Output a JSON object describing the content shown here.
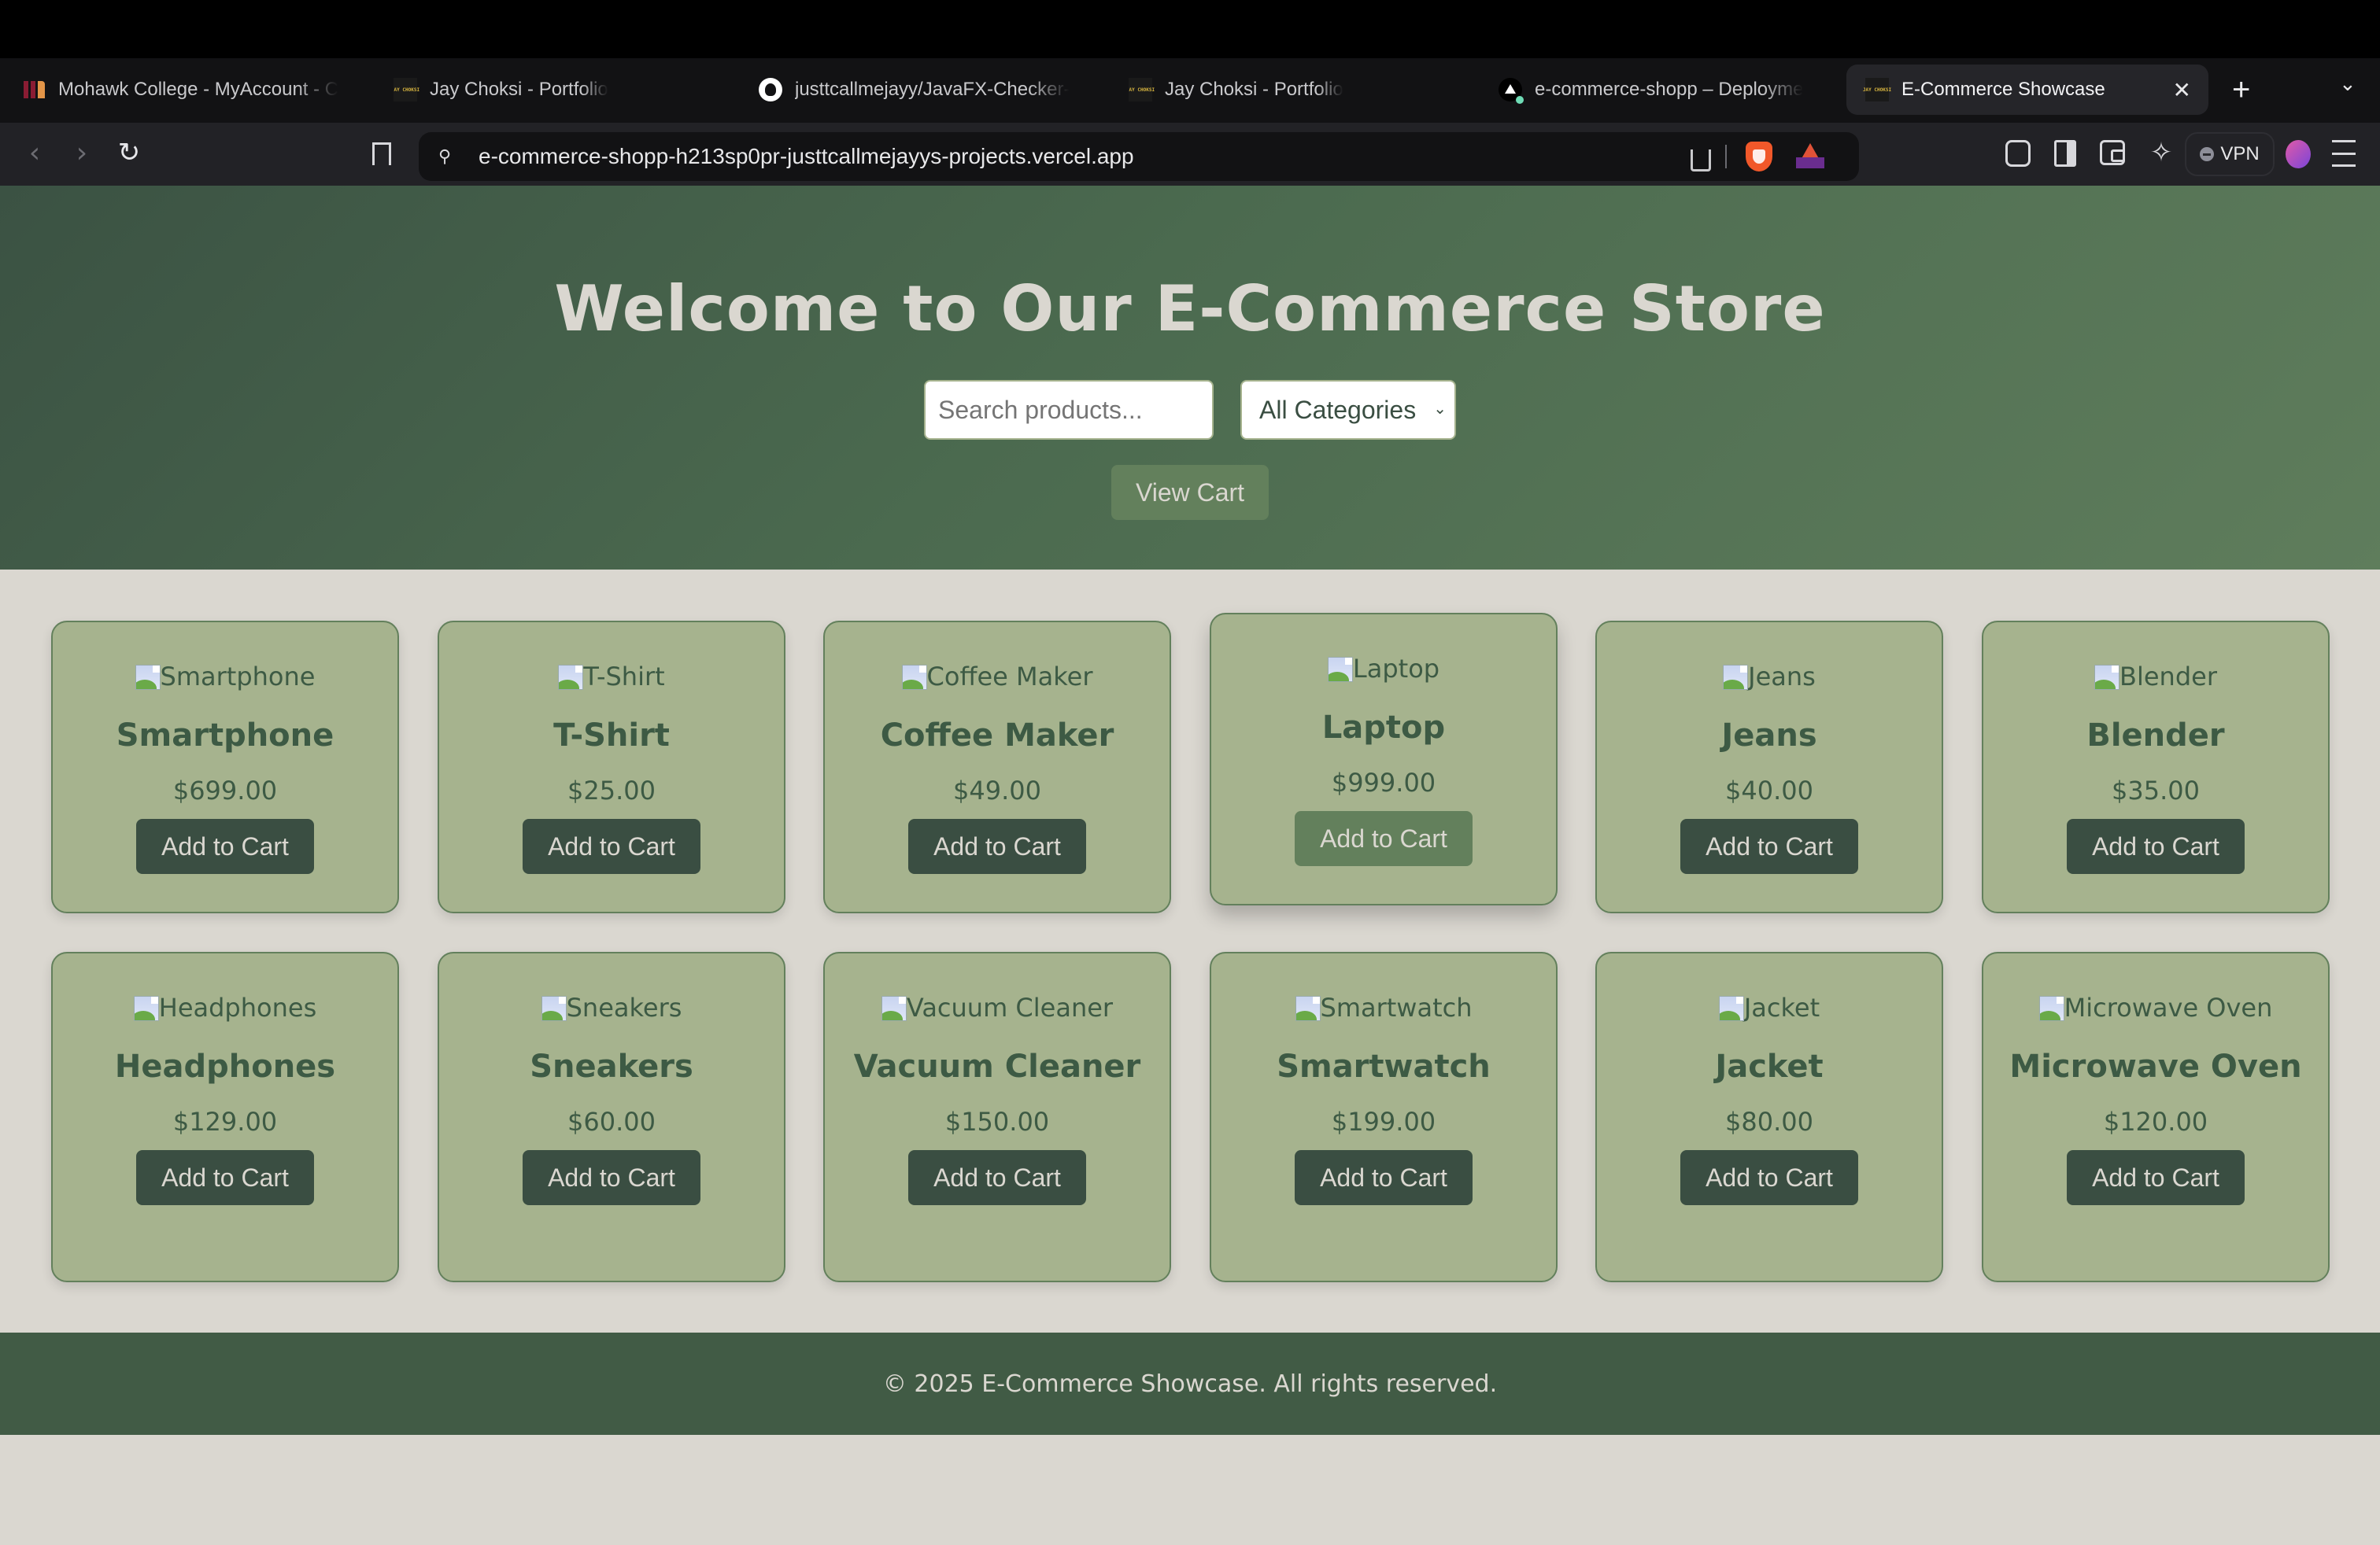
{
  "browser": {
    "tabs": [
      {
        "title": "Mohawk College - MyAccount - C",
        "favicon": "mohawk-icon",
        "active": false
      },
      {
        "title": "Jay Choksi - Portfolio",
        "favicon": "jay-choksi-icon",
        "active": false
      },
      {
        "title": "justtcallmejayy/JavaFX-Checker-",
        "favicon": "github-icon",
        "active": false
      },
      {
        "title": "Jay Choksi - Portfolio",
        "favicon": "jay-choksi-icon",
        "active": false
      },
      {
        "title": "e-commerce-shopp – Deployme",
        "favicon": "vercel-icon",
        "active": false
      },
      {
        "title": "E-Commerce Showcase",
        "favicon": "jay-choksi-icon",
        "active": true
      }
    ],
    "favicon_text": "JAY CHOKSI",
    "url": "e-commerce-shopp-h213sp0pr-justtcallmejayys-projects.vercel.app",
    "vpn_label": "VPN",
    "close_tab_glyph": "✕",
    "new_tab_glyph": "+",
    "tab_menu_glyph": "⌄",
    "back_glyph": "‹",
    "forward_glyph": "›",
    "reload_glyph": "↻",
    "leo_glyph": "✧",
    "tune_glyph": "⚲"
  },
  "header": {
    "title": "Welcome to Our E-Commerce Store",
    "search_placeholder": "Search products...",
    "search_value": "",
    "category_selected": "All Categories",
    "view_cart_label": "View Cart"
  },
  "products": [
    {
      "name": "Smartphone",
      "alt": "Smartphone",
      "price": "$699.00",
      "button": "Add to Cart"
    },
    {
      "name": "T-Shirt",
      "alt": "T-Shirt",
      "price": "$25.00",
      "button": "Add to Cart"
    },
    {
      "name": "Coffee Maker",
      "alt": "Coffee Maker",
      "price": "$49.00",
      "button": "Add to Cart"
    },
    {
      "name": "Laptop",
      "alt": "Laptop",
      "price": "$999.00",
      "button": "Add to Cart",
      "hovered": true
    },
    {
      "name": "Jeans",
      "alt": "Jeans",
      "price": "$40.00",
      "button": "Add to Cart"
    },
    {
      "name": "Blender",
      "alt": "Blender",
      "price": "$35.00",
      "button": "Add to Cart"
    },
    {
      "name": "Headphones",
      "alt": "Headphones",
      "price": "$129.00",
      "button": "Add to Cart"
    },
    {
      "name": "Sneakers",
      "alt": "Sneakers",
      "price": "$60.00",
      "button": "Add to Cart"
    },
    {
      "name": "Vacuum Cleaner",
      "alt": "Vacuum Cleaner",
      "price": "$150.00",
      "button": "Add to Cart"
    },
    {
      "name": "Smartwatch",
      "alt": "Smartwatch",
      "price": "$199.00",
      "button": "Add to Cart"
    },
    {
      "name": "Jacket",
      "alt": "Jacket",
      "price": "$80.00",
      "button": "Add to Cart"
    },
    {
      "name": "Microwave Oven",
      "alt": "Microwave Oven",
      "price": "$120.00",
      "button": "Add to Cart"
    }
  ],
  "footer": {
    "text": "© 2025 E-Commerce Showcase. All rights reserved."
  },
  "colors": {
    "header_dark": "#3b5243",
    "header_light": "#5f7d5c",
    "card_bg": "#a6b38e",
    "card_border": "#63805c",
    "button_bg": "#3a4e42",
    "button_hover_bg": "#63805c",
    "text_green": "#3d5a44",
    "page_bg": "#dad7d0",
    "footer_bg": "#415b45"
  }
}
